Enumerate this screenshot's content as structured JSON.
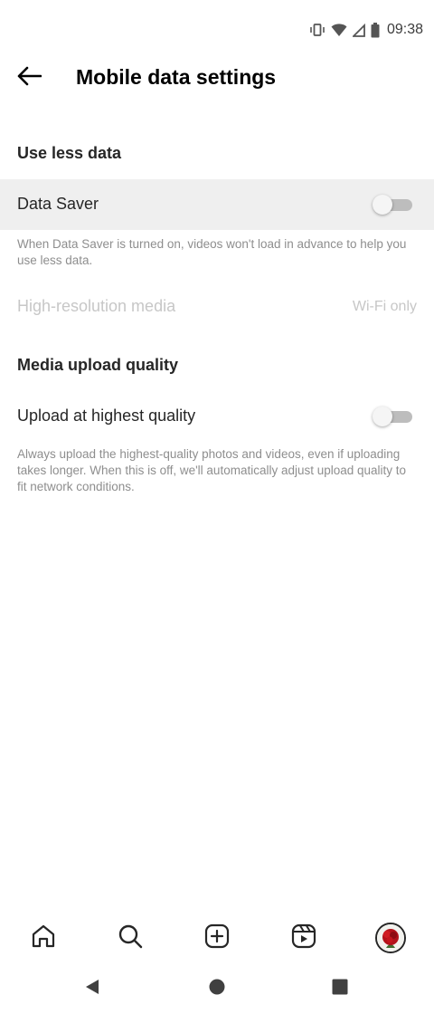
{
  "status_bar": {
    "time": "09:38",
    "icons": [
      "vibrate-icon",
      "wifi-icon",
      "signal-icon",
      "battery-icon"
    ]
  },
  "header": {
    "back_icon": "arrow-left-icon",
    "title": "Mobile data settings"
  },
  "use_less_data": {
    "section_title": "Use less data",
    "data_saver_label": "Data Saver",
    "data_saver_on": false,
    "data_saver_description": "When Data Saver is turned on, videos won't load in advance to help you use less data.",
    "high_res_label": "High-resolution media",
    "high_res_value": "Wi-Fi only"
  },
  "media_upload": {
    "section_title": "Media upload quality",
    "upload_label": "Upload at highest quality",
    "upload_on": false,
    "upload_description": "Always upload the highest-quality photos and videos, even if uploading takes longer. When this is off, we'll automatically adjust upload quality to fit network conditions."
  },
  "bottom_nav": {
    "items": [
      "home-icon",
      "search-icon",
      "create-icon",
      "reels-icon",
      "profile-avatar"
    ]
  },
  "system_nav": {
    "items": [
      "back-triangle-icon",
      "home-circle-icon",
      "recents-square-icon"
    ]
  },
  "colors": {
    "text": "#262626",
    "secondary_text": "#8e8e8e",
    "disabled_text": "#c7c7c7",
    "highlight_row": "#efefef",
    "toggle_track": "#bdbdbd"
  }
}
